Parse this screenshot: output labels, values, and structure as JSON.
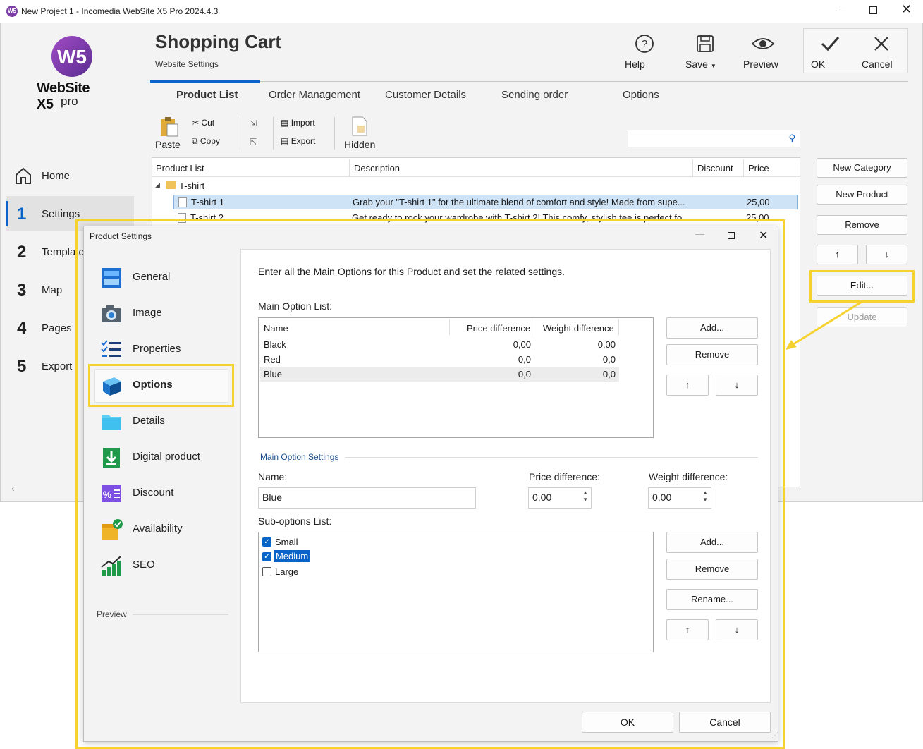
{
  "window": {
    "title": "New Project 1 - Incomedia WebSite X5 Pro 2024.4.3"
  },
  "logo": {
    "line1": "WebSite X5",
    "line2": "pro"
  },
  "header": {
    "title": "Shopping Cart",
    "subtitle": "Website Settings"
  },
  "toolbar": {
    "help": "Help",
    "save": "Save",
    "preview": "Preview",
    "ok": "OK",
    "cancel": "Cancel"
  },
  "tabs": [
    "Product List",
    "Order Management",
    "Customer Details",
    "Sending order",
    "Options"
  ],
  "edit_toolbar": {
    "paste": "Paste",
    "cut": "Cut",
    "copy": "Copy",
    "import": "Import",
    "export": "Export",
    "hidden": "Hidden"
  },
  "nav": [
    {
      "num": "",
      "label": "Home"
    },
    {
      "num": "1",
      "label": "Settings"
    },
    {
      "num": "2",
      "label": "Template"
    },
    {
      "num": "3",
      "label": "Map"
    },
    {
      "num": "4",
      "label": "Pages"
    },
    {
      "num": "5",
      "label": "Export"
    }
  ],
  "product_table": {
    "headers": [
      "Product List",
      "Description",
      "Discount",
      "Price"
    ],
    "category": "T-shirt",
    "rows": [
      {
        "name": "T-shirt 1",
        "desc": "Grab your \"T-shirt 1\" for the ultimate blend of comfort and style! Made from supe...",
        "price": "25,00"
      },
      {
        "name": "T-shirt 2",
        "desc": "Get ready to rock your wardrobe with T-shirt 2! This comfy, stylish tee is perfect fo...",
        "price": "25,00"
      }
    ]
  },
  "right_buttons": {
    "new_category": "New Category",
    "new_product": "New Product",
    "remove": "Remove",
    "up": "↑",
    "down": "↓",
    "edit": "Edit...",
    "update": "Update"
  },
  "dialog": {
    "title": "Product Settings",
    "menu": [
      "General",
      "Image",
      "Properties",
      "Options",
      "Details",
      "Digital product",
      "Discount",
      "Availability",
      "SEO"
    ],
    "preview_label": "Preview",
    "intro": "Enter all the Main Options for this Product and set the related settings.",
    "main_list_label": "Main Option List:",
    "main_headers": [
      "Name",
      "Price difference",
      "Weight difference"
    ],
    "main_rows": [
      {
        "name": "Black",
        "price": "0,00",
        "weight": "0,00"
      },
      {
        "name": "Red",
        "price": "0,0",
        "weight": "0,0"
      },
      {
        "name": "Blue",
        "price": "0,0",
        "weight": "0,0"
      }
    ],
    "main_buttons": {
      "add": "Add...",
      "remove": "Remove",
      "up": "↑",
      "down": "↓"
    },
    "settings_group": "Main Option Settings",
    "name_label": "Name:",
    "name_value": "Blue",
    "price_label": "Price difference:",
    "price_value": "0,00",
    "weight_label": "Weight difference:",
    "weight_value": "0,00",
    "sub_label": "Sub-options List:",
    "sub_options": [
      {
        "label": "Small",
        "checked": true
      },
      {
        "label": "Medium",
        "checked": true
      },
      {
        "label": "Large",
        "checked": false
      }
    ],
    "sub_buttons": {
      "add": "Add...",
      "remove": "Remove",
      "rename": "Rename...",
      "up": "↑",
      "down": "↓"
    },
    "ok": "OK",
    "cancel": "Cancel"
  },
  "colors": {
    "highlight": "#f5d22e",
    "accent": "#0a64c8",
    "selection": "#cfe3f7"
  }
}
